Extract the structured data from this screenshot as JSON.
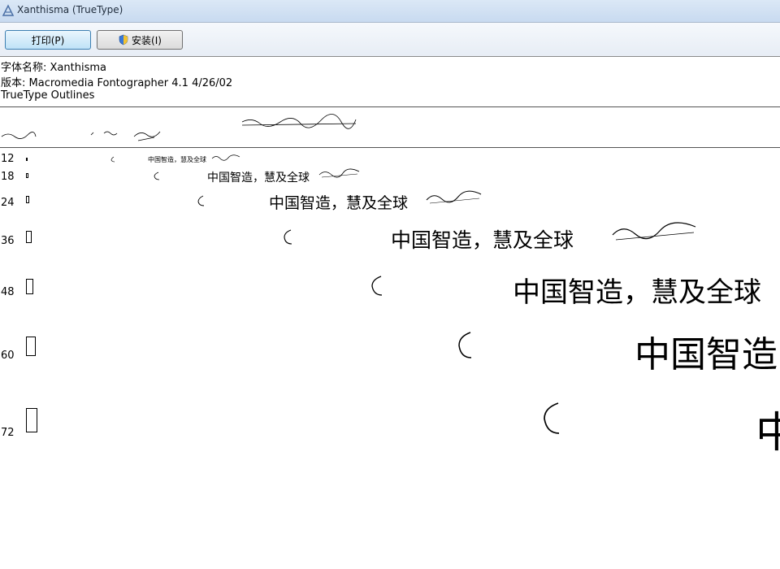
{
  "window": {
    "title": "Xanthisma (TrueType)"
  },
  "toolbar": {
    "print_label": "打印(P)",
    "install_label": "安装(I)"
  },
  "info": {
    "font_name": "字体名称: Xanthisma",
    "version": "版本: Macromedia Fontographer 4.1 4/26/02",
    "outline_type": "TrueType Outlines"
  },
  "samples": {
    "sizes": [
      "12",
      "18",
      "24",
      "36",
      "48",
      "60",
      "72"
    ],
    "cjk_text": "中国智造，慧及全球"
  },
  "colors": {
    "titlebar": "#c8daf0",
    "button_focus": "#bfe2f7",
    "rule": "#555555"
  }
}
